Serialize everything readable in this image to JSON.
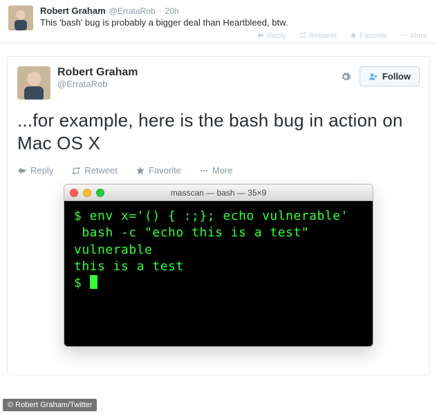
{
  "parent_tweet": {
    "author_name": "Robert Graham",
    "author_handle": "@ErrataRob",
    "time_sep": "·",
    "time": "20h",
    "text": "This 'bash' bug is probably a bigger deal than Heartbleed, btw.",
    "actions": {
      "reply": "Reply",
      "retweet": "Retweet",
      "favorite": "Favorite",
      "more": "More"
    }
  },
  "main_tweet": {
    "author_name": "Robert Graham",
    "author_handle": "@ErrataRob",
    "follow_label": "Follow",
    "text": "...for example, here is the bash bug in action on Mac OS X",
    "actions": {
      "reply": "Reply",
      "retweet": "Retweet",
      "favorite": "Favorite",
      "more": "More"
    }
  },
  "terminal": {
    "title": "masscan — bash — 35×9",
    "lines": [
      "$ env x='() { :;}; echo vulnerable'",
      " bash -c \"echo this is a test\"",
      "vulnerable",
      "this is a test",
      "$ "
    ]
  },
  "credit": "© Robert Graham/Twitter",
  "icons": {
    "reply": "reply-icon",
    "retweet": "retweet-icon",
    "favorite": "star-icon",
    "more": "dots-icon",
    "gear": "gear-icon",
    "follow": "user-plus-icon"
  }
}
